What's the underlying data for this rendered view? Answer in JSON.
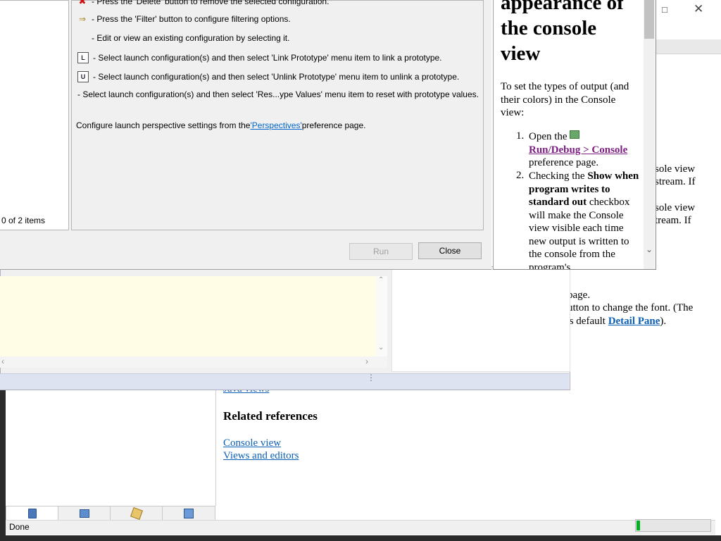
{
  "help_browser": {
    "status_text": "Done",
    "progress_fraction": 0.05,
    "right_fragments": {
      "line1": "sole view",
      "line2": "stream.  If",
      "line3": "sole view",
      "line4": "tream.  If",
      "line5": "page.",
      "line6_pre": "utton to change the font.  (The",
      "line7_pre": "'s default ",
      "line7_link": "Detail Pane",
      "line7_post": ")."
    },
    "java_views_link": "Java views",
    "related_heading": "Related references",
    "related_links": [
      "Console view",
      "Views and editors"
    ],
    "nav_tabs": [
      {
        "icon": "contents-icon"
      },
      {
        "icon": "index-icon"
      },
      {
        "icon": "search-results-icon"
      },
      {
        "icon": "bookmarks-icon"
      }
    ]
  },
  "launch_dialog": {
    "items_count": "0 of 2 items",
    "info_lines": [
      {
        "icon": "delete-icon",
        "text": "- Press the 'Delete' button to remove the selected configuration."
      },
      {
        "icon": "filter-icon",
        "text": "- Press the 'Filter' button to configure filtering options."
      },
      {
        "icon": "",
        "text": "- Edit or view an existing configuration by selecting it."
      },
      {
        "icon": "link-prototype-icon",
        "text": "- Select launch configuration(s) and then select 'Link Prototype' menu item to link a prototype."
      },
      {
        "icon": "unlink-prototype-icon",
        "text": "- Select launch configuration(s) and then select 'Unlink Prototype' menu item to unlink a prototype."
      },
      {
        "icon": "",
        "text": "- Select launch configuration(s) and then select 'Res...ype Values' menu item to reset with prototype values."
      }
    ],
    "perspective_pre": "Configure launch perspective settings from the ",
    "perspective_link": "'Perspectives'",
    "perspective_post": " preference page.",
    "run_label": "Run",
    "close_label": "Close"
  },
  "article": {
    "heading_line1": "appearance of",
    "heading_line2": "the console",
    "heading_line3": "view",
    "intro": "To set the types of output (and their colors) in the Console view:",
    "step1_pre": "Open the ",
    "step1_link": "Run/Debug > Console",
    "step1_post": " preference page.",
    "step2_pre": "Checking the ",
    "step2_bold": "Show when program writes to standard out",
    "step2_post": " checkbox will make the Console view visible each time new output is written to the console from the program's"
  }
}
